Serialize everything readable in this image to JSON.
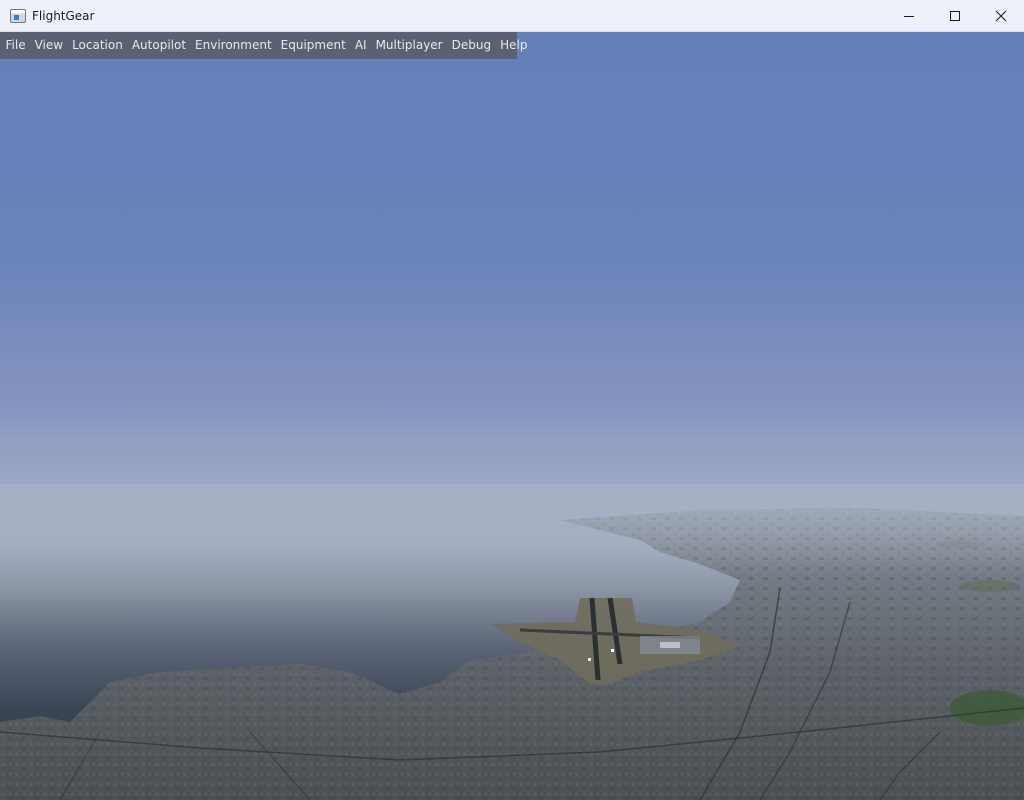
{
  "window": {
    "title": "FlightGear",
    "icon": "flightgear-app-icon",
    "controls": [
      "minimize-icon",
      "maximize-icon",
      "close-icon"
    ]
  },
  "menu": {
    "items": [
      {
        "label": "File"
      },
      {
        "label": "View"
      },
      {
        "label": "Location"
      },
      {
        "label": "Autopilot"
      },
      {
        "label": "Environment"
      },
      {
        "label": "Equipment"
      },
      {
        "label": "AI"
      },
      {
        "label": "Multiplayer"
      },
      {
        "label": "Debug"
      },
      {
        "label": "Help"
      }
    ]
  },
  "colors": {
    "sky_top": "#6380b9",
    "sky_horizon": "#9aa8c4",
    "haze": "#8c98ad",
    "water": "#2c3646",
    "land": "#54595c",
    "titlebar": "#eef2f8"
  }
}
